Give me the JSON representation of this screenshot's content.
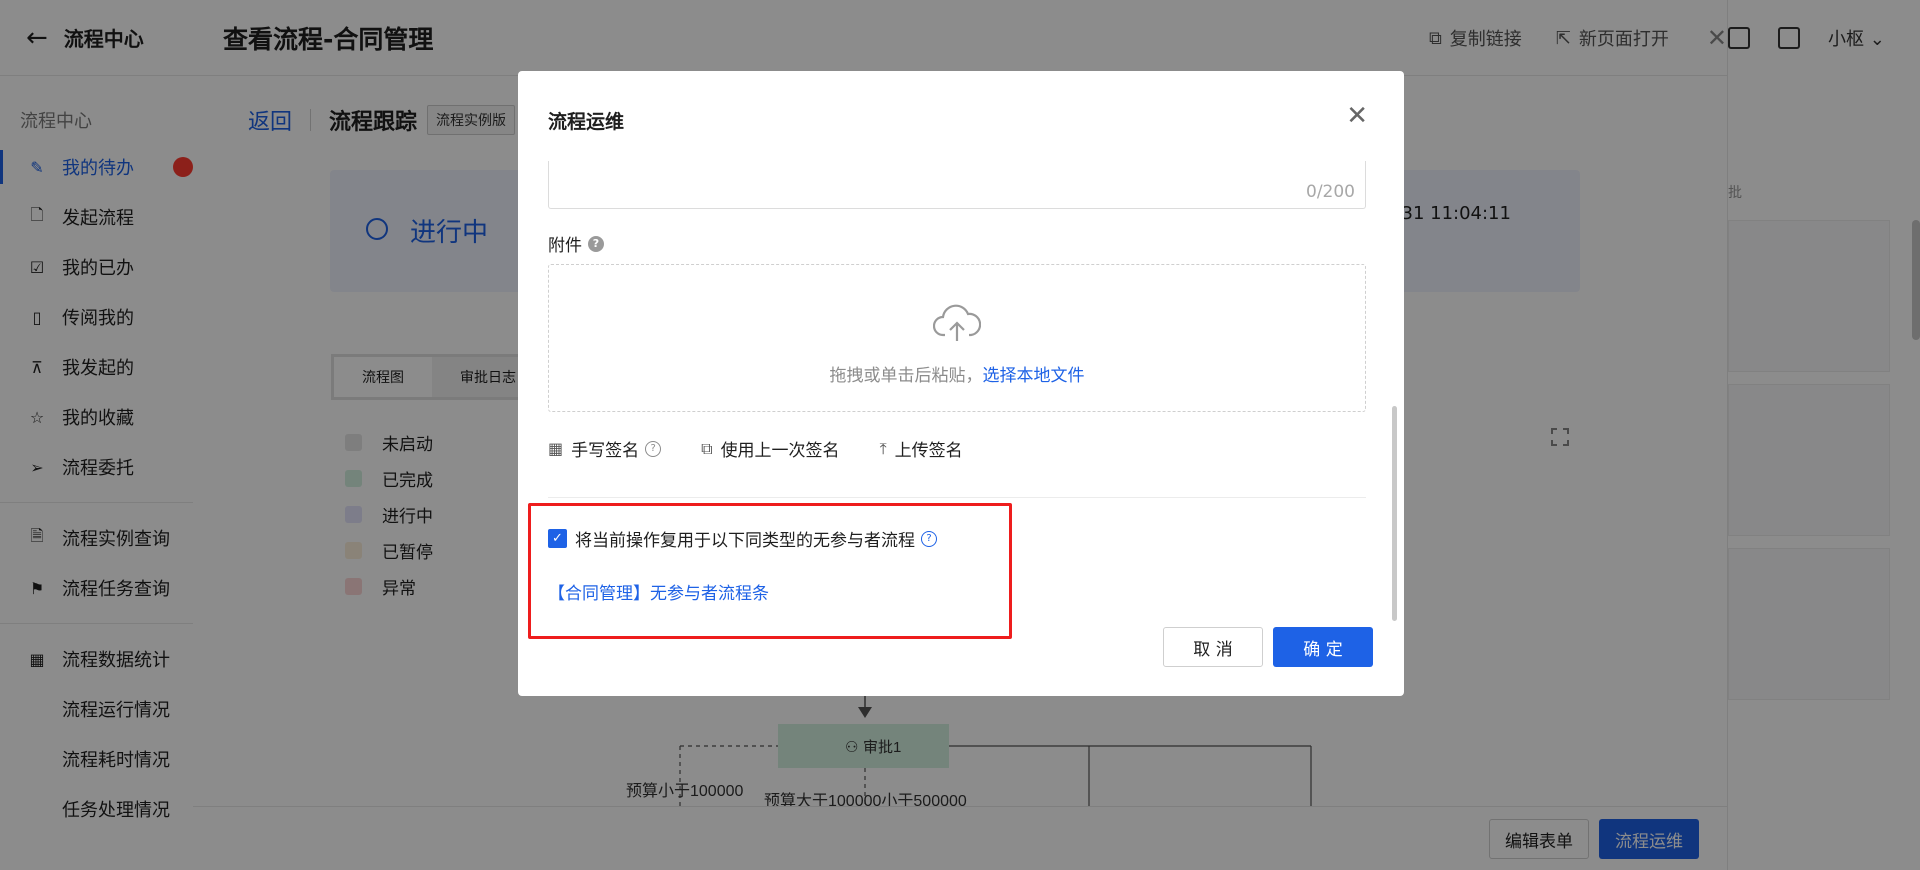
{
  "sidebar": {
    "back_label": "流程中心",
    "section_label": "流程中心",
    "items": [
      {
        "label": "我的待办",
        "icon": "edit-icon"
      },
      {
        "label": "发起流程",
        "icon": "file-add-icon"
      },
      {
        "label": "我的已办",
        "icon": "calendar-check-icon"
      },
      {
        "label": "传阅我的",
        "icon": "file-icon"
      },
      {
        "label": "我发起的",
        "icon": "org-icon"
      },
      {
        "label": "我的收藏",
        "icon": "star-icon"
      },
      {
        "label": "流程委托",
        "icon": "send-icon"
      }
    ],
    "query_items": [
      {
        "label": "流程实例查询",
        "icon": "doc-search-icon"
      },
      {
        "label": "流程任务查询",
        "icon": "flag-icon"
      }
    ],
    "stats_label": "流程数据统计",
    "stats_items": [
      "流程运行情况",
      "流程耗时情况",
      "任务处理情况"
    ]
  },
  "right_strip": {
    "user": "小枢",
    "label": "批"
  },
  "drawer": {
    "title": "查看流程-合同管理",
    "actions": {
      "copy_link": "复制链接",
      "new_page": "新页面打开"
    },
    "tracking": {
      "back": "返回",
      "title": "流程跟踪",
      "tag": "流程实例版"
    },
    "status": {
      "text": "进行中",
      "time": "-31 11:04:11"
    },
    "tabs": [
      "流程图",
      "审批日志"
    ],
    "legend": [
      {
        "label": "未启动",
        "color": "#e6e6e6"
      },
      {
        "label": "已完成",
        "color": "#d3f1e0"
      },
      {
        "label": "进行中",
        "color": "#e3e3fb"
      },
      {
        "label": "已暂停",
        "color": "#fbeedb"
      },
      {
        "label": "异常",
        "color": "#fbd6d6"
      }
    ],
    "flow": {
      "node": "审批1",
      "edge_a": "预算小于100000",
      "edge_b": "预算大于100000小于500000"
    },
    "footer": {
      "edit_form": "编辑表单",
      "ops": "流程运维"
    }
  },
  "modal": {
    "title": "流程运维",
    "textarea_count": "0/200",
    "attachment_label": "附件",
    "upload_text": "拖拽或单击后粘贴，",
    "upload_link": "选择本地文件",
    "sign_options": [
      "手写签名",
      "使用上一次签名",
      "上传签名"
    ],
    "reuse_checkbox": "将当前操作复用于以下同类型的无参与者流程",
    "reuse_link": "【合同管理】无参与者流程条",
    "cancel": "取 消",
    "confirm": "确 定"
  },
  "colors": {
    "primary": "#1e62e6",
    "highlight_box": "#ee1d1d"
  }
}
